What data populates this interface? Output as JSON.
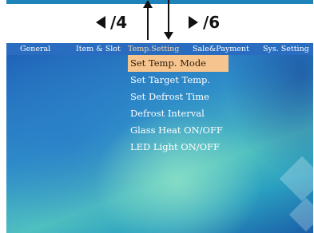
{
  "nav_hints": {
    "left": "/4",
    "right": "/6"
  },
  "tabs": [
    {
      "label": "General",
      "active": false
    },
    {
      "label": "Item & Slot",
      "active": false
    },
    {
      "label": "Temp.Setting",
      "active": true
    },
    {
      "label": "Sale&Payment",
      "active": false
    },
    {
      "label": "Sys. Setting",
      "active": false
    }
  ],
  "menu": [
    {
      "label": "Set Temp. Mode",
      "selected": true
    },
    {
      "label": "Set Target Temp.",
      "selected": false
    },
    {
      "label": "Set Defrost Time",
      "selected": false
    },
    {
      "label": "Defrost Interval",
      "selected": false
    },
    {
      "label": "Glass Heat ON/OFF",
      "selected": false
    },
    {
      "label": "LED Light ON/OFF",
      "selected": false
    }
  ],
  "colors": {
    "accent_selected": "#f6c48e",
    "tab_active": "#f6d6a3",
    "tab_bar": "#2a6dc0"
  },
  "icons": [
    "left-triangle-icon",
    "right-triangle-icon",
    "up-arrow-icon",
    "down-arrow-icon"
  ]
}
